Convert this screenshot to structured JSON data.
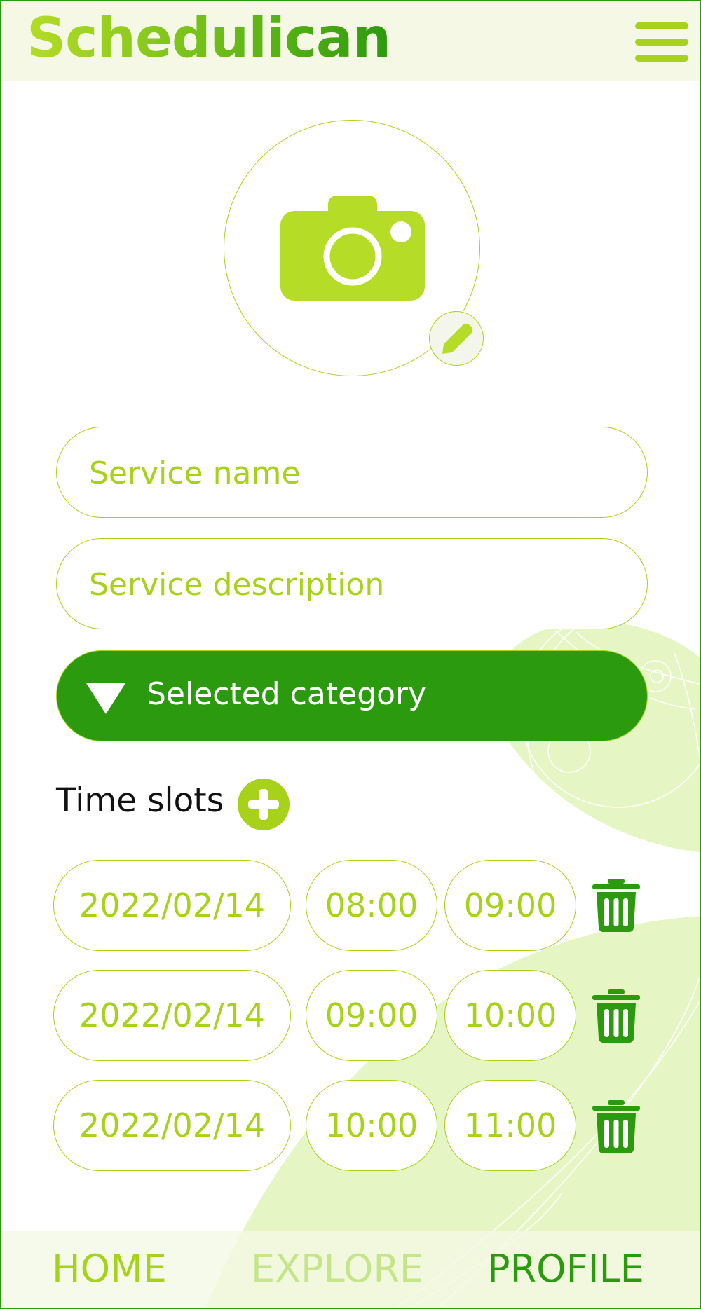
{
  "app": {
    "name": "Schedulican",
    "menu_icon": "hamburger-menu-icon"
  },
  "colors": {
    "accent": "#a8d21a",
    "primary_dark": "#2c9a0e",
    "header_bg": "#f4f8e4",
    "deco_bg": "#e6f5c4"
  },
  "image_picker": {
    "icon": "camera-icon",
    "edit_icon": "pencil-icon"
  },
  "form": {
    "service_name_placeholder": "Service name",
    "service_description_placeholder": "Service description",
    "category_label": "Selected category",
    "category_icon": "triangle-down-icon"
  },
  "time_slots": {
    "title": "Time slots",
    "add_icon": "plus-circle-icon",
    "delete_icon": "trash-icon",
    "items": [
      {
        "date": "2022/02/14",
        "start": "08:00",
        "end": "09:00"
      },
      {
        "date": "2022/02/14",
        "start": "09:00",
        "end": "10:00"
      },
      {
        "date": "2022/02/14",
        "start": "10:00",
        "end": "11:00"
      }
    ]
  },
  "bottom_nav": {
    "home": "HOME",
    "explore": "EXPLORE",
    "profile": "PROFILE"
  }
}
